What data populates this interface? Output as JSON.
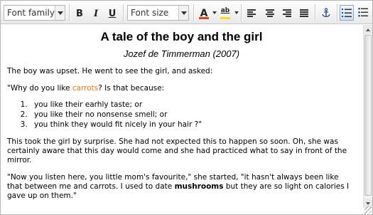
{
  "toolbar": {
    "font_family": {
      "label": "Font family"
    },
    "bold": {
      "label": "B"
    },
    "italic": {
      "label": "I"
    },
    "underline": {
      "label": "U"
    },
    "font_size": {
      "label": "Font size"
    },
    "text_color": {
      "label": "A",
      "color": "#e0401a"
    },
    "highlight_color": {
      "label": "ab",
      "color": "#f5e000"
    },
    "align_buttons": [
      "align-left",
      "align-center",
      "align-right",
      "align-justify"
    ],
    "anchor_icon": "anchor-icon",
    "numbered_list_active": true
  },
  "document": {
    "title": "A tale of the boy and the girl",
    "author": "Jozef de Timmerman (2007)",
    "p1": "The boy was upset. He went to see the girl, and asked:",
    "p2_before": "\"Why do you like ",
    "p2_link": "carrots",
    "p2_after": "? Is that because:",
    "list": [
      "you like their earhly taste; or",
      "you like their no nonsense smell; or",
      "you think they would fit nicely in your hair ?\""
    ],
    "p3": "This took the girl by surprise. She had not expected this to happen so soon. Oh, she was certainly aware that this day would come and she had practiced what to say in front of the mirror.",
    "p4_before": "\"Now you listen here, you little mom's favourite,\" she started, \"it hasn't always been like that between me and carrots. I used to date ",
    "p4_bold": "mushrooms",
    "p4_after": " but they are so light on calories I gave up on them.\""
  },
  "colors": {
    "link": "#e0781a",
    "active_button_border": "#8aa6cf"
  }
}
